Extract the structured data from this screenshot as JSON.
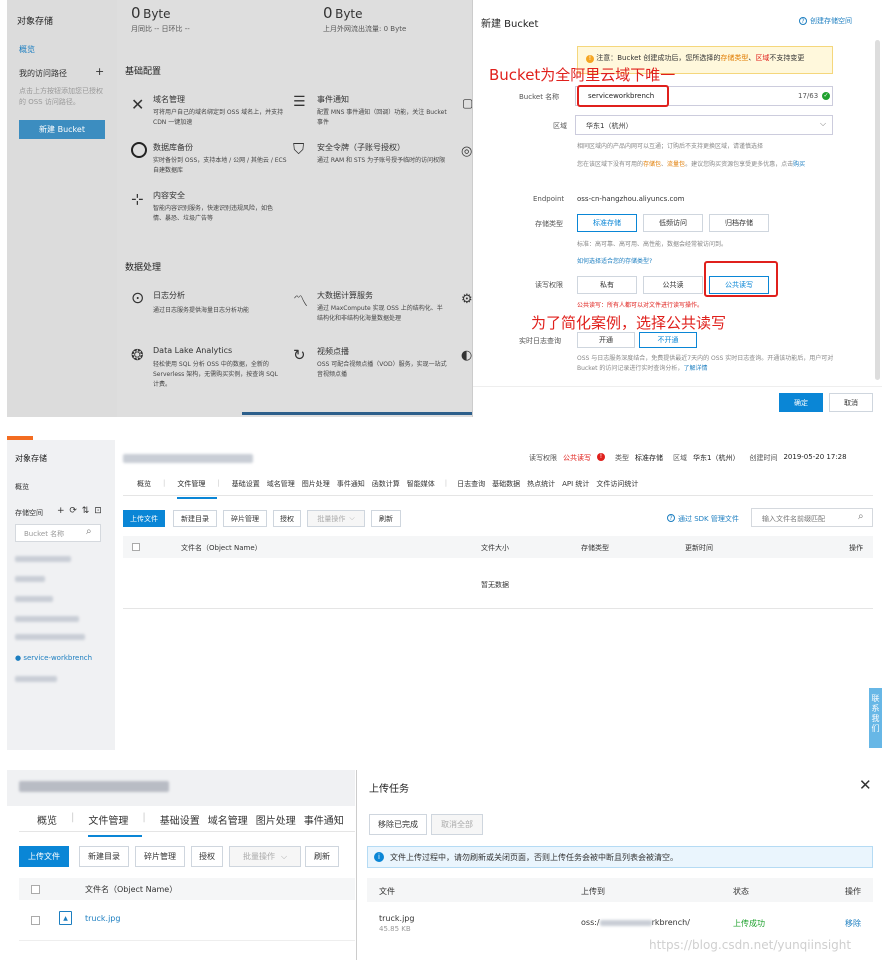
{
  "p1": {
    "sidebar": {
      "title": "对象存储",
      "overview": "概览",
      "recent": "我的访问路径",
      "add": "+",
      "hint": "点击上方按钮添加您已授权的 OSS 访问路径。",
      "new_bucket": "新建 Bucket"
    },
    "stats": [
      {
        "value": "0",
        "unit": "Byte",
        "sub": "月同比 -- 日环比 --"
      },
      {
        "value": "0",
        "unit": "Byte",
        "sub": "上月外网流出流量: 0 Byte"
      }
    ],
    "section1": "基础配置",
    "section2": "数据处理",
    "cards": [
      {
        "icon": "domain-icon",
        "title": "域名管理",
        "desc": "可将用户自己的域名绑定到 OSS 域名上，并支持 CDN 一键加速"
      },
      {
        "icon": "notify-icon",
        "title": "事件通知",
        "desc": "配置 MNS 事件通知（回调）功能，关注 Bucket 事件"
      },
      {
        "icon": "backup-icon",
        "title": "数据库备份",
        "desc": "实时备份到 OSS，支持本地 / 公网 / 其他云 / ECS 自建数据库"
      },
      {
        "icon": "shield-icon",
        "title": "安全令牌（子账号授权）",
        "desc": "通过 RAM 和 STS 为子账号授予临时的访问权限"
      },
      {
        "icon": "content-icon",
        "title": "内容安全",
        "desc": "智能内容识别服务，快速识别违规风险，如色情、暴恐、垃圾广告等"
      },
      {
        "icon": "log-icon",
        "title": "日志分析",
        "desc": "通过日志服务提供海量日志分析功能"
      },
      {
        "icon": "bigdata-icon",
        "title": "大数据计算服务",
        "desc": "通过 MaxCompute 实现 OSS 上的结构化、半结构化和非结构化海量数据处理"
      },
      {
        "icon": "datalake-icon",
        "title": "Data Lake Analytics",
        "desc": "轻松使用 SQL 分析 OSS 中的数据，全新的 Serverless 架构，无需购买实例，按查询 SQL 计费。"
      },
      {
        "icon": "video-icon",
        "title": "视频点播",
        "desc": "OSS 可配合视频点播（VOD）服务，实现一站式音视频点播"
      }
    ],
    "dialog": {
      "title": "新建 Bucket",
      "help": "创建存储空间",
      "warn_prefix": "注意：Bucket 创建成功后，您所选择的",
      "warn_hl1": "存储类型",
      "warn_mid": "、",
      "warn_hl2": "区域",
      "warn_suffix": "不支持变更",
      "annot1": "Bucket为全阿里云域下唯一",
      "name_label": "Bucket 名称",
      "name_value": "serviceworkbrench",
      "name_count": "17/63",
      "region_label": "区域",
      "region_value": "华东1（杭州）",
      "region_note1": "相同区域内的产品内网可以互通；订购后不支持更换区域，请谨慎选择",
      "region_note2a": "您在该区域下没有可用的",
      "region_note2b": "存储包",
      "region_note2c": "、",
      "region_note2d": "流量包",
      "region_note2e": "。建议您购买资源包享受更多优惠，点击",
      "region_note2f": "购买",
      "endpoint_label": "Endpoint",
      "endpoint_value": "oss-cn-hangzhou.aliyuncs.com",
      "storage_label": "存储类型",
      "storage_opts": [
        "标准存储",
        "低频访问",
        "归档存储"
      ],
      "storage_note": "标准：高可靠、高可用、高性能，数据会经常被访问到。",
      "storage_link": "如何选择适合您的存储类型?",
      "acl_label": "读写权限",
      "acl_opts": [
        "私有",
        "公共读",
        "公共读写"
      ],
      "acl_warn": "公共读写：所有人都可以对文件进行读写操作。",
      "annot2": "为了简化案例，选择公共读写",
      "log_label": "实时日志查询",
      "log_opts": [
        "开通",
        "不开通"
      ],
      "log_note": "OSS 与日志服务深度结合，免费提供最近7天内的 OSS 实时日志查询。开通该功能后，用户可对 Bucket 的访问记录进行实时查询分析，",
      "log_link": "了解详情",
      "ok": "确定",
      "cancel": "取消"
    }
  },
  "p2": {
    "sidebar": {
      "title": "对象存储",
      "overview": "概览",
      "space": "存储空间",
      "icons": "+ ⟳ ⇅ ⊡",
      "search_ph": "Bucket 名称",
      "active_bucket": "service-workbrench"
    },
    "header": {
      "acl_label": "读写权限",
      "acl_value": "公共读写",
      "type_label": "类型",
      "type_value": "标准存储",
      "region_label": "区域",
      "region_value": "华东1（杭州）",
      "created_label": "创建时间",
      "created_value": "2019-05-20 17:28"
    },
    "tabs": [
      "概览",
      "文件管理",
      "基础设置",
      "域名管理",
      "图片处理",
      "事件通知",
      "函数计算",
      "智能媒体",
      "日志查询",
      "基础数据",
      "热点统计",
      "API 统计",
      "文件访问统计"
    ],
    "toolbar": [
      "上传文件",
      "新建目录",
      "碎片管理",
      "授权",
      "批量操作",
      "刷新"
    ],
    "sdk_link": "通过 SDK 管理文件",
    "search_ph": "输入文件名前缀匹配",
    "columns": [
      "文件名（Object Name）",
      "文件大小",
      "存储类型",
      "更新时间",
      "操作"
    ],
    "empty": "暂无数据",
    "contact": "联系我们"
  },
  "p3": {
    "tabs": [
      "概览",
      "文件管理",
      "基础设置",
      "域名管理",
      "图片处理",
      "事件通知"
    ],
    "toolbar": [
      "上传文件",
      "新建目录",
      "碎片管理",
      "授权",
      "批量操作",
      "刷新"
    ],
    "col_name": "文件名（Object Name）",
    "file": "truck.jpg",
    "upload": {
      "title": "上传任务",
      "remove_done": "移除已完成",
      "cancel_all": "取消全部",
      "info": "文件上传过程中，请勿刷新或关闭页面，否则上传任务会被中断且列表会被清空。",
      "cols": [
        "文件",
        "上传到",
        "状态",
        "操作"
      ],
      "row": {
        "name": "truck.jpg",
        "size": "45.85 KB",
        "dest_prefix": "oss:/",
        "dest_suffix": "rkbrench/",
        "status": "上传成功",
        "action": "移除"
      }
    },
    "watermark": "https://blog.csdn.net/yunqiinsight"
  }
}
